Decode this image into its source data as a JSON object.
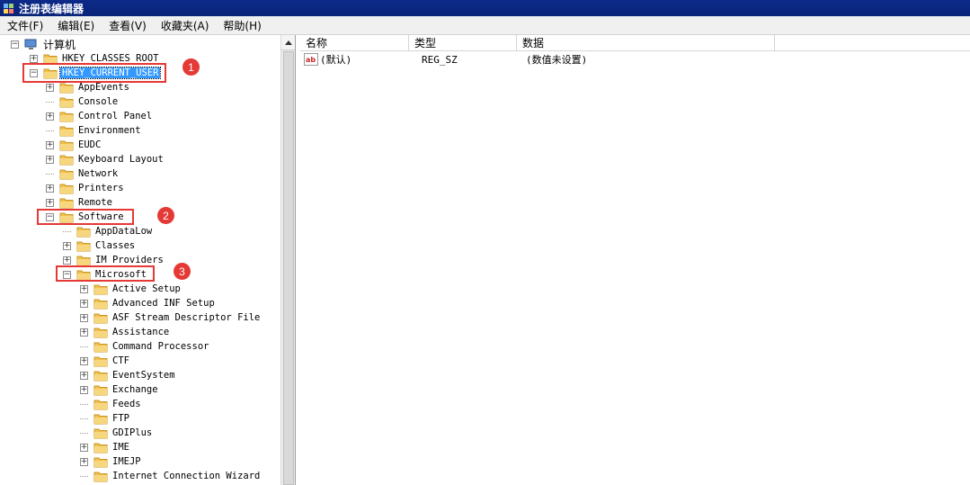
{
  "window": {
    "title": "注册表编辑器"
  },
  "menu": [
    "文件(F)",
    "编辑(E)",
    "查看(V)",
    "收藏夹(A)",
    "帮助(H)"
  ],
  "tree": {
    "root": "计算机",
    "items": [
      {
        "label": "HKEY_CLASSES_ROOT",
        "expander": "+"
      },
      {
        "label": "HKEY_CURRENT_USER",
        "expander": "-"
      },
      {
        "label": "AppEvents",
        "expander": "+"
      },
      {
        "label": "Console",
        "expander": ""
      },
      {
        "label": "Control Panel",
        "expander": "+"
      },
      {
        "label": "Environment",
        "expander": ""
      },
      {
        "label": "EUDC",
        "expander": "+"
      },
      {
        "label": "Keyboard Layout",
        "expander": "+"
      },
      {
        "label": "Network",
        "expander": ""
      },
      {
        "label": "Printers",
        "expander": "+"
      },
      {
        "label": "Remote",
        "expander": "+"
      },
      {
        "label": "Software",
        "expander": "-"
      },
      {
        "label": "AppDataLow",
        "expander": ""
      },
      {
        "label": "Classes",
        "expander": "+"
      },
      {
        "label": "IM Providers",
        "expander": "+"
      },
      {
        "label": "Microsoft",
        "expander": "-"
      },
      {
        "label": "Active Setup",
        "expander": "+"
      },
      {
        "label": "Advanced INF Setup",
        "expander": "+"
      },
      {
        "label": "ASF Stream Descriptor File",
        "expander": "+"
      },
      {
        "label": "Assistance",
        "expander": "+"
      },
      {
        "label": "Command Processor",
        "expander": ""
      },
      {
        "label": "CTF",
        "expander": "+"
      },
      {
        "label": "EventSystem",
        "expander": "+"
      },
      {
        "label": "Exchange",
        "expander": "+"
      },
      {
        "label": "Feeds",
        "expander": ""
      },
      {
        "label": "FTP",
        "expander": ""
      },
      {
        "label": "GDIPlus",
        "expander": ""
      },
      {
        "label": "IME",
        "expander": "+"
      },
      {
        "label": "IMEJP",
        "expander": "+"
      },
      {
        "label": "Internet Connection Wizard",
        "expander": ""
      }
    ]
  },
  "annotations": [
    "1",
    "2",
    "3"
  ],
  "list": {
    "columns": [
      "名称",
      "类型",
      "数据"
    ],
    "rows": [
      {
        "name": "(默认)",
        "type": "REG_SZ",
        "data": "(数值未设置)",
        "icon": "ab"
      }
    ]
  },
  "colors": {
    "title_bg": "#0d2a8a",
    "selection": "#3399ff",
    "annotation": "#e53935",
    "folder": "#f2c14e"
  }
}
